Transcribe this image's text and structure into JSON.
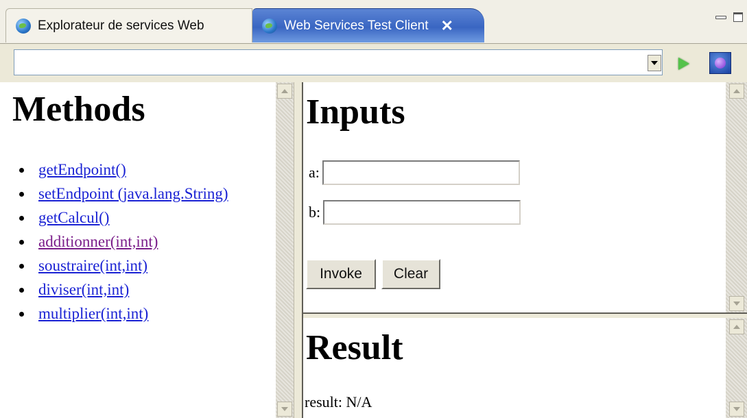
{
  "tabs": [
    {
      "label": "Explorateur de services Web",
      "icon": "globe-icon",
      "active": false
    },
    {
      "label": "Web Services Test Client",
      "icon": "globe-icon",
      "active": true,
      "closable": true
    }
  ],
  "toolbar": {
    "address_value": "",
    "go_icon": "play-icon",
    "ws_icon": "web-services-icon"
  },
  "methods": {
    "title": "Methods",
    "items": [
      {
        "label": "getEndpoint()"
      },
      {
        "label": "setEndpoint (java.lang.String)"
      },
      {
        "label": "getCalcul()"
      },
      {
        "label": "additionner(int,int)",
        "visited": true
      },
      {
        "label": "soustraire(int,int)"
      },
      {
        "label": "diviser(int,int)"
      },
      {
        "label": "multiplier(int,int)"
      }
    ]
  },
  "inputs": {
    "title": "Inputs",
    "fields": [
      {
        "label": "a:",
        "value": ""
      },
      {
        "label": "b:",
        "value": ""
      }
    ],
    "invoke_label": "Invoke",
    "clear_label": "Clear"
  },
  "result": {
    "title": "Result",
    "label": "result:",
    "value": "N/A"
  },
  "colors": {
    "link": "#1a22d4",
    "visited_link": "#7a1d8a",
    "active_tab": "#3a66c2"
  }
}
